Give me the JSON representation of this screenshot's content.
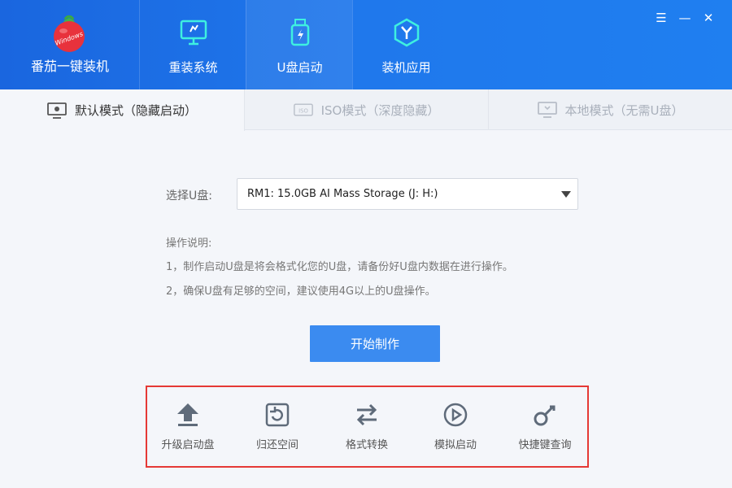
{
  "app": {
    "name": "番茄一键装机",
    "logo_text": "Windows"
  },
  "nav": [
    {
      "label": "重装系统",
      "icon": "monitor-icon"
    },
    {
      "label": "U盘启动",
      "icon": "usb-icon"
    },
    {
      "label": "装机应用",
      "icon": "apps-icon"
    }
  ],
  "window_controls": {
    "menu": "☰",
    "minimize": "—",
    "close": "✕"
  },
  "tabs": [
    {
      "label": "默认模式（隐藏启动）",
      "icon": "monitor-icon",
      "active": true
    },
    {
      "label": "ISO模式（深度隐藏）",
      "icon": "iso-icon",
      "active": false
    },
    {
      "label": "本地模式（无需U盘）",
      "icon": "computer-icon",
      "active": false
    }
  ],
  "usb_select": {
    "label": "选择U盘:",
    "value": "RM1: 15.0GB AI Mass Storage (J: H:)"
  },
  "instructions": {
    "title": "操作说明:",
    "lines": [
      "1，制作启动U盘是将会格式化您的U盘，请备份好U盘内数据在进行操作。",
      "2，确保U盘有足够的空间，建议使用4G以上的U盘操作。"
    ]
  },
  "start_button": "开始制作",
  "tools": [
    {
      "label": "升级启动盘",
      "icon": "upload-arrow-icon"
    },
    {
      "label": "归还空间",
      "icon": "restore-icon"
    },
    {
      "label": "格式转换",
      "icon": "swap-arrows-icon"
    },
    {
      "label": "模拟启动",
      "icon": "play-icon"
    },
    {
      "label": "快捷键查询",
      "icon": "key-icon"
    }
  ],
  "colors": {
    "header": "#1f78ec",
    "button": "#3b8bf0",
    "highlight_border": "#e53935"
  }
}
